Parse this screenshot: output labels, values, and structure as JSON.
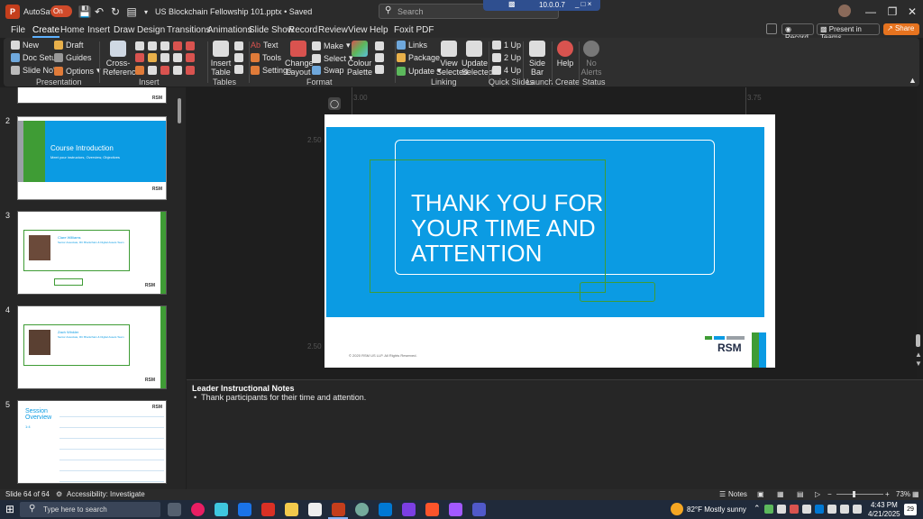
{
  "titlebar": {
    "autosave_label": "AutoSave",
    "autosave_state": "On",
    "doc_title": "US Blockchain Fellowship 101.pptx • Saved",
    "search_placeholder": "Search",
    "remote_ip": "10.0.0.7"
  },
  "ribbon_tabs": [
    "File",
    "Create",
    "Home",
    "Insert",
    "Draw",
    "Design",
    "Transitions",
    "Animations",
    "Slide Show",
    "Record",
    "Review",
    "View",
    "Help",
    "Foxit PDF"
  ],
  "ribbon_right": {
    "record": "Record",
    "present": "Present in Teams",
    "share": "Share"
  },
  "ribbon": {
    "presentation": {
      "new": "New",
      "draft": "Draft",
      "doc_setup": "Doc Setup",
      "guides": "Guides",
      "slide_nos": "Slide No's",
      "options": "Options",
      "label": "Presentation"
    },
    "insert": {
      "cross_reference": "Cross-\nReference",
      "label": "Insert"
    },
    "tables": {
      "insert_table": "Insert\nTable",
      "label": "Tables"
    },
    "format": {
      "text": "Text",
      "tools": "Tools",
      "settings": "Settings",
      "change_layout": "Change\nLayout",
      "make": "Make",
      "select": "Select",
      "swap": "Swap",
      "colour_palette": "Colour\nPalette",
      "label": "Format"
    },
    "linking": {
      "links": "Links",
      "package": "Package",
      "update": "Update",
      "view_selected": "View\nSelected",
      "update_selected": "Update\nSelected",
      "label": "Linking"
    },
    "quick_slides": {
      "up1": "1 Up",
      "up2": "2 Up",
      "up4": "4 Up",
      "label": "Quick Slides"
    },
    "launch": {
      "side_bar": "Side\nBar",
      "label": "Launch"
    },
    "create": {
      "help": "Help",
      "label": "Create"
    },
    "status": {
      "no_alerts": "No\nAlerts",
      "label": "Status"
    }
  },
  "thumbnails": [
    {
      "num": "2",
      "title": "Course Introduction",
      "subtitle": "Meet your instructors, Overview, Objectives"
    },
    {
      "num": "3",
      "name": "Clare Williams",
      "role": "Senior Associate, RC Blockchain & Digital Assets Team"
    },
    {
      "num": "4",
      "name": "Zach Winkler",
      "role": "Senior Associate, RC Blockchain & Digital Assets Team"
    },
    {
      "num": "5",
      "title": "Session Overview",
      "subtitle": "1:4"
    }
  ],
  "thumb_logo": "RSM",
  "ruler": {
    "left": "3.00",
    "right": "3.75",
    "v1": "2.50",
    "v2": "2.50"
  },
  "slide": {
    "headline": "THANK YOU FOR YOUR TIME AND ATTENTION",
    "copyright": "© 2020 RSM US LLP. All Rights Reserved.",
    "logo": "RSM",
    "colors": {
      "blue": "#0b9be3",
      "green": "#3f9c35",
      "gray": "#9aa0a6"
    }
  },
  "notes": {
    "heading": "Leader Instructional Notes",
    "bullet": "Thank participants for their time and attention."
  },
  "statusbar": {
    "slide_count": "Slide 64 of 64",
    "accessibility": "Accessibility: Investigate",
    "notes": "Notes",
    "zoom": "73%"
  },
  "taskbar": {
    "search_placeholder": "Type here to search",
    "weather": "82°F  Mostly sunny",
    "time": "4:43 PM",
    "date": "4/21/2025",
    "notif_count": "29"
  }
}
